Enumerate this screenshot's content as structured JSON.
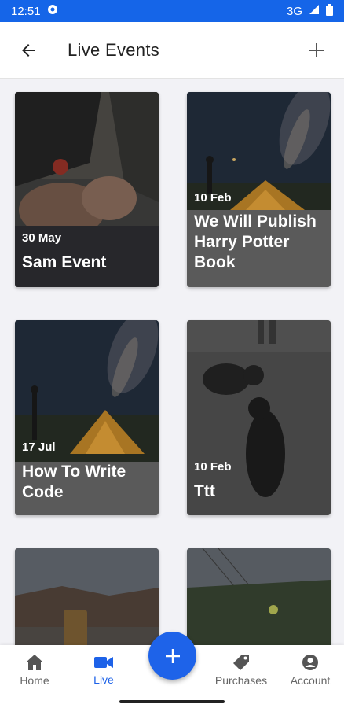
{
  "status": {
    "time": "12:51",
    "network": "3G"
  },
  "header": {
    "title": "Live Events"
  },
  "events": [
    {
      "date": "30 May",
      "name": "Sam Event"
    },
    {
      "date": "10 Feb",
      "name": "We Will Publish Harry Potter Book"
    },
    {
      "date": "17 Jul",
      "name": "How To Write Code"
    },
    {
      "date": "10 Feb",
      "name": "Ttt"
    }
  ],
  "nav": {
    "home": "Home",
    "live": "Live",
    "purchases": "Purchases",
    "account": "Account"
  },
  "colors": {
    "accent": "#1e63e9",
    "status_bar": "#1565e8"
  },
  "icons": {
    "back": "arrow-left-icon",
    "add": "plus-icon",
    "home": "home-icon",
    "live": "video-camera-icon",
    "purchases": "tag-icon",
    "account": "account-circle-icon",
    "fab": "plus-icon"
  }
}
